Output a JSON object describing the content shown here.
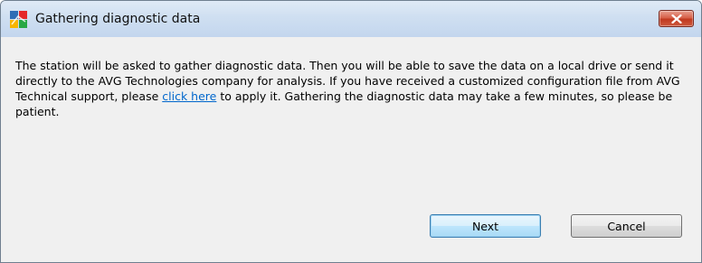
{
  "window": {
    "title": "Gathering diagnostic data",
    "icon": "avg-logo-icon"
  },
  "message": {
    "before_link": "The station will be asked to gather diagnostic data. Then you will be able to save the data on a local drive or send it directly to the AVG Technologies company for analysis. If you have received a customized configuration file from AVG Technical support, please",
    "link_text": "click here",
    "after_link": "to apply it. Gathering the diagnostic data may take a few minutes, so please be patient."
  },
  "buttons": {
    "next": "Next",
    "cancel": "Cancel"
  },
  "colors": {
    "link": "#0066cc",
    "close_button": "#c1391f",
    "titlebar": "#cfdff1"
  }
}
